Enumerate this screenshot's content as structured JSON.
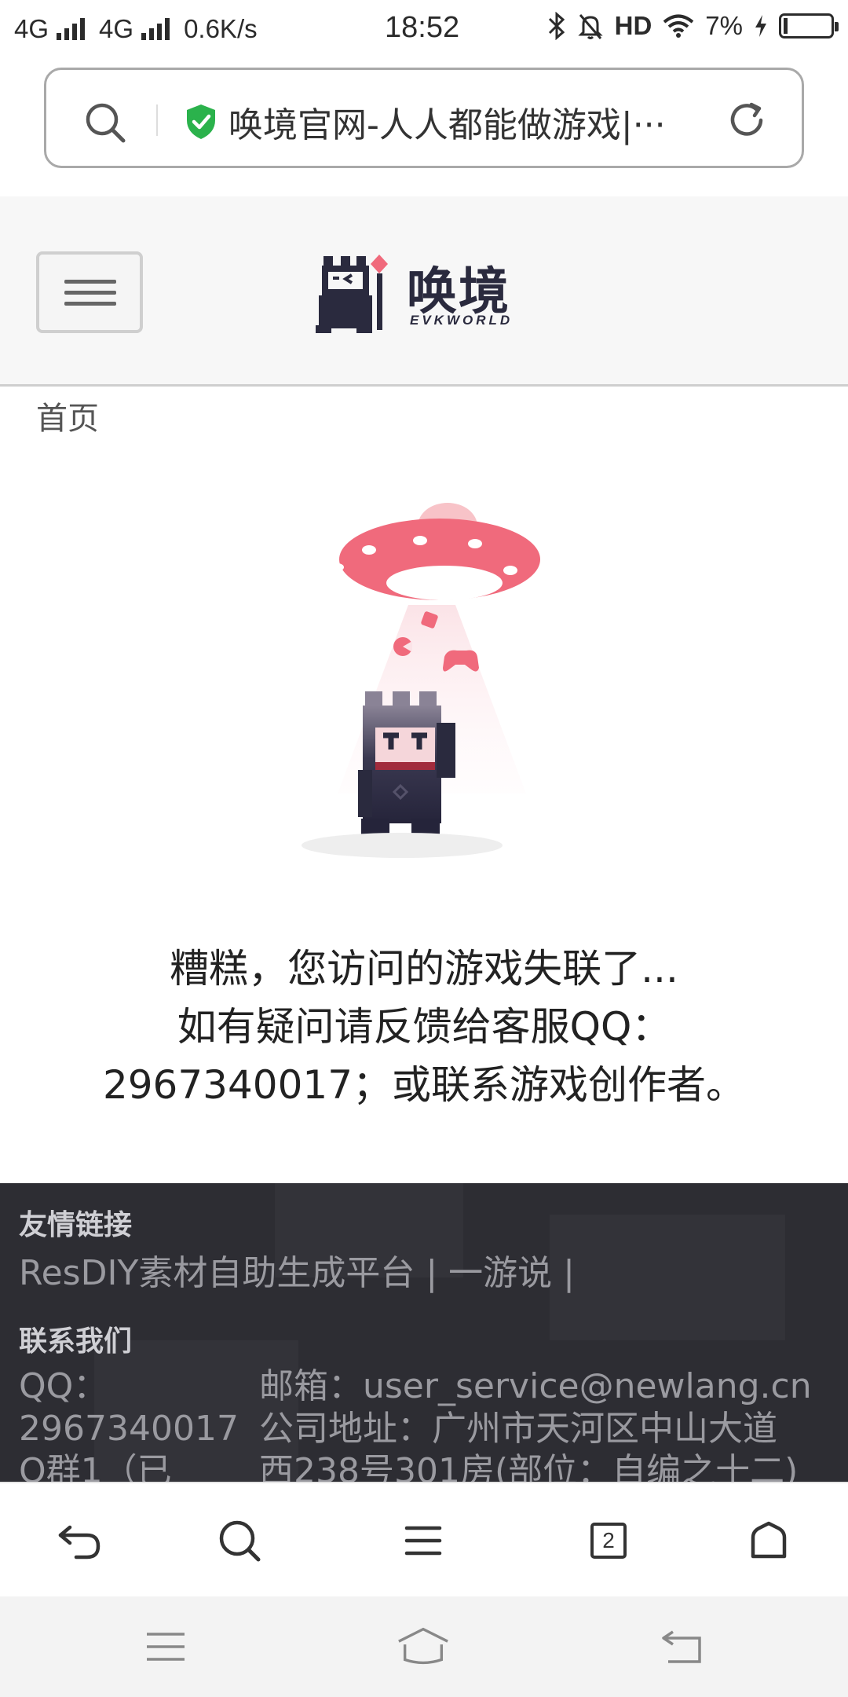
{
  "status_bar": {
    "network1": "4G",
    "network2": "4G",
    "speed": "0.6K/s",
    "time": "18:52",
    "hd": "HD",
    "battery": "7%"
  },
  "address_bar": {
    "url_text": "唤境官网-人人都能做游戏|···"
  },
  "header": {
    "logo_text": "唤境",
    "logo_sub": "EVKWORLD"
  },
  "breadcrumb": "首页",
  "message": {
    "line1": "糟糕，您访问的游戏失联了...",
    "line2": "如有疑问请反馈给客服QQ：",
    "line3": "2967340017；或联系游戏创作者。"
  },
  "footer": {
    "links_title": "友情链接",
    "link1": "ResDIY素材自助生成平台",
    "sep1": " | ",
    "link2": "一游说",
    "sep2": " |",
    "contact_title": "联系我们",
    "qq_label": "QQ：",
    "qq_number": "2967340017",
    "qq_group": "Q群1（已",
    "email": "邮箱：user_service@newlang.cn",
    "address1": "公司地址：广州市天河区中山大道",
    "address2": "西238号301房(部位：自编之十二)"
  },
  "toolbar": {
    "tab_count": "2"
  },
  "colors": {
    "accent_pink": "#f06a7c",
    "dark_navy": "#2a2a3e",
    "footer_bg": "#2d2d33",
    "secure_green": "#2bb24c"
  }
}
